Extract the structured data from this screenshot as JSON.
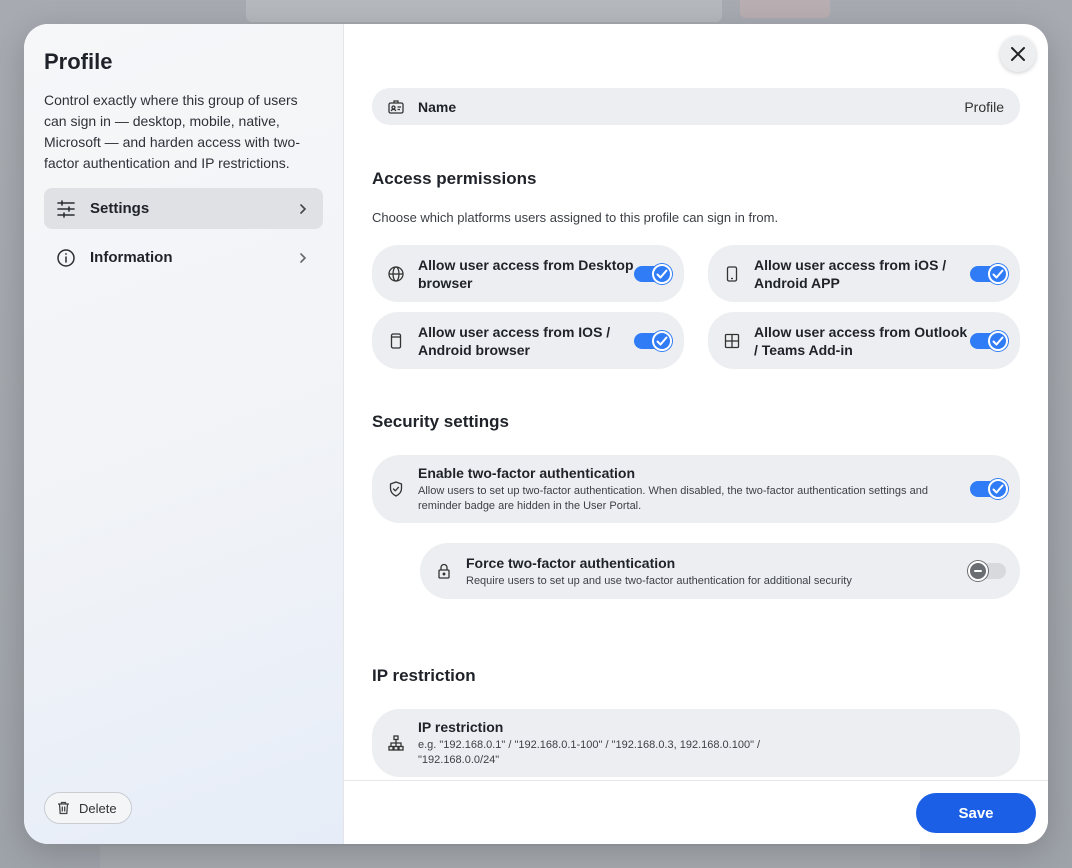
{
  "sidebar": {
    "title": "Profile",
    "description": "Control exactly where this group of users can sign in — desktop, mobile, native, Microsoft — and harden access with two-factor authentication and IP restrictions.",
    "items": [
      {
        "label": "Settings",
        "icon": "sliders-icon",
        "active": true
      },
      {
        "label": "Information",
        "icon": "info-icon",
        "active": false
      }
    ],
    "delete_label": "Delete"
  },
  "main": {
    "name_row": {
      "label": "Name",
      "value": "Profile",
      "icon": "id-card-icon"
    },
    "access": {
      "title": "Access permissions",
      "description": "Choose which platforms users assigned to this profile can sign in from.",
      "items": [
        {
          "label": "Allow user access from Desktop browser",
          "icon": "globe-icon",
          "enabled": true
        },
        {
          "label": "Allow user access from iOS / Android APP",
          "icon": "phone-icon",
          "enabled": true
        },
        {
          "label": "Allow user access from IOS / Android browser",
          "icon": "phone-browser-icon",
          "enabled": true
        },
        {
          "label": "Allow user access from Outlook / Teams Add-in",
          "icon": "grid-icon",
          "enabled": true
        }
      ]
    },
    "security": {
      "title": "Security settings",
      "two_factor": {
        "title": "Enable two-factor authentication",
        "description": "Allow users to set up two-factor authentication. When disabled, the two-factor authentication settings and reminder badge are hidden in the User Portal.",
        "icon": "shield-check-icon",
        "enabled": true
      },
      "force_two_factor": {
        "title": "Force two-factor authentication",
        "description": "Require users to set up and use two-factor authentication for additional security",
        "icon": "lock-icon",
        "enabled": false
      }
    },
    "ip": {
      "title": "IP restriction",
      "row_title": "IP restriction",
      "row_hint": "e.g. \"192.168.0.1\" / \"192.168.0.1-100\" / \"192.168.0.3, 192.168.0.100\" / \"192.168.0.0/24\"",
      "icon": "network-icon"
    }
  },
  "footer": {
    "save_label": "Save"
  },
  "colors": {
    "accent": "#2f7cf6",
    "primary_button": "#1b5fe6",
    "pill_bg": "#eceef1"
  }
}
